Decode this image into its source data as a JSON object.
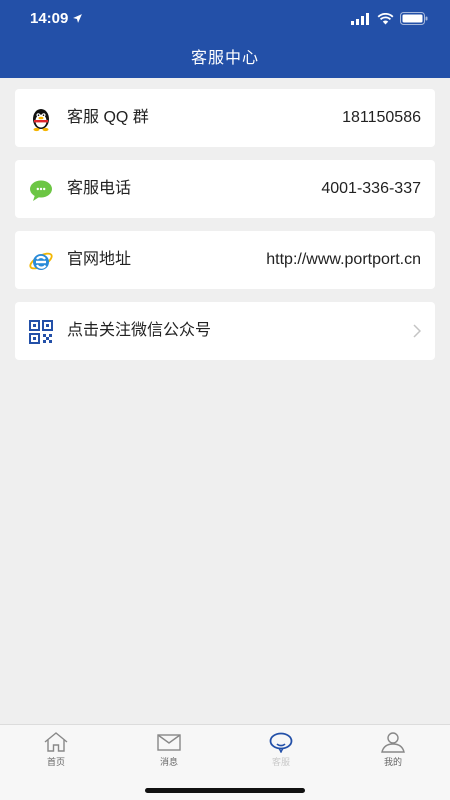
{
  "status_bar": {
    "time": "14:09"
  },
  "header": {
    "title": "客服中心"
  },
  "items": [
    {
      "label": "客服 QQ 群",
      "value": "181150586",
      "icon": "qq-penguin-icon"
    },
    {
      "label": "客服电话",
      "value": "4001-336-337",
      "icon": "chat-bubble-icon"
    },
    {
      "label": "官网地址",
      "value": "http://www.portport.cn",
      "icon": "ie-browser-icon"
    },
    {
      "label": "点击关注微信公众号",
      "icon": "qr-code-icon",
      "chevron": "chevron-right-icon"
    }
  ],
  "tabbar": {
    "tabs": [
      {
        "label": "首页",
        "icon": "home-icon"
      },
      {
        "label": "消息",
        "icon": "mail-icon"
      },
      {
        "label": "客服",
        "icon": "customer-service-icon",
        "active": true
      },
      {
        "label": "我的",
        "icon": "user-icon"
      }
    ]
  },
  "colors": {
    "primary": "#2350a8",
    "background": "#efefef",
    "card": "#ffffff"
  }
}
